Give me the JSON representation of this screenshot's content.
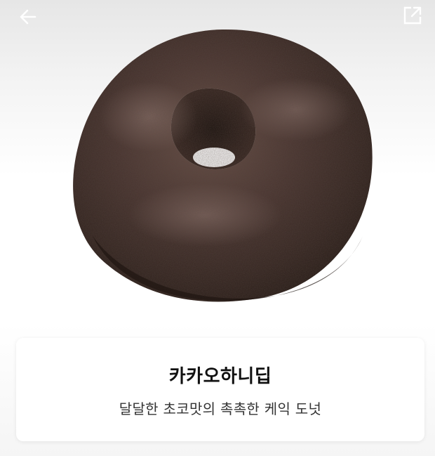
{
  "header": {
    "back_icon": "arrow-left-icon",
    "share_icon": "external-share-icon",
    "icon_color": "#ffffff"
  },
  "product": {
    "image_icon": "chocolate-donut-image",
    "name": "카카오하니딥",
    "description": "달달한 초코맛의 촉촉한 케익 도넛"
  }
}
